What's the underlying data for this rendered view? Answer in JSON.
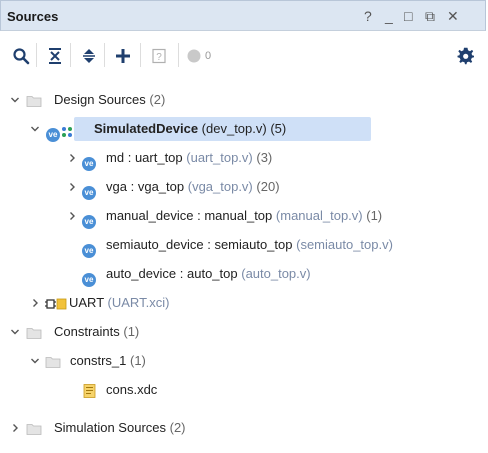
{
  "window": {
    "title": "Sources",
    "help": "?",
    "minimize": "_",
    "maximize": "□",
    "float": "⧉",
    "close": "✕"
  },
  "toolbar": {
    "badge_count": "0"
  },
  "tree": {
    "design_sources": {
      "label": "Design Sources",
      "count": "(2)"
    },
    "top": {
      "name": "SimulatedDevice",
      "file": "(dev_top.v)",
      "count": "(5)"
    },
    "children": [
      {
        "inst": "md",
        "module": "uart_top",
        "file": "(uart_top.v)",
        "count": "(3)"
      },
      {
        "inst": "vga",
        "module": "vga_top",
        "file": "(vga_top.v)",
        "count": "(20)"
      },
      {
        "inst": "manual_device",
        "module": "manual_top",
        "file": "(manual_top.v)",
        "count": "(1)"
      },
      {
        "inst": "semiauto_device",
        "module": "semiauto_top",
        "file": "(semiauto_top.v)",
        "count": ""
      },
      {
        "inst": "auto_device",
        "module": "auto_top",
        "file": "(auto_top.v)",
        "count": ""
      }
    ],
    "uart": {
      "name": "UART",
      "file": "(UART.xci)"
    },
    "constraints": {
      "label": "Constraints",
      "count": "(1)"
    },
    "constrs": {
      "label": "constrs_1",
      "count": "(1)"
    },
    "xdc": {
      "label": "cons.xdc"
    },
    "sim_sources": {
      "label": "Simulation Sources",
      "count": "(2)"
    },
    "ve_text": "ve",
    "colon": ":"
  }
}
